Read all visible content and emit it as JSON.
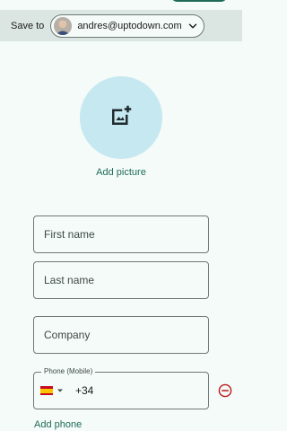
{
  "save_to": {
    "label": "Save to",
    "account_email": "andres@uptodown.com",
    "avatar_icon": "user-avatar",
    "dropdown_icon": "chevron-down-icon"
  },
  "picture": {
    "icon": "add-photo-icon",
    "label": "Add picture"
  },
  "fields": {
    "first_name": {
      "placeholder": "First name"
    },
    "last_name": {
      "placeholder": "Last name"
    },
    "company": {
      "placeholder": "Company"
    }
  },
  "phone": {
    "legend": "Phone (Mobile)",
    "country_flag": "spain-flag",
    "code": "+34",
    "remove_icon": "remove-circle-icon"
  },
  "actions": {
    "add_phone": "Add phone"
  },
  "colors": {
    "accent": "#1f6b57",
    "picture_bg": "#c6e8f0",
    "bar_bg": "#dbe5e1",
    "background": "#f4fbf8",
    "remove": "#ba1a1a"
  }
}
